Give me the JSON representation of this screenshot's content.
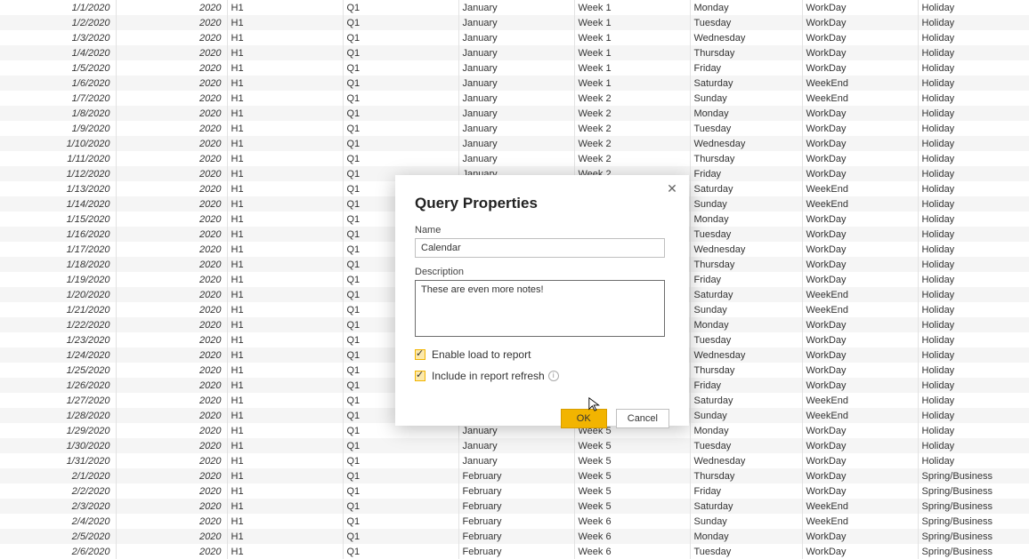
{
  "dialog": {
    "title": "Query Properties",
    "name_label": "Name",
    "name_value": "Calendar",
    "desc_label": "Description",
    "desc_value": "These are even more notes!",
    "chk_load": "Enable load to report",
    "chk_refresh": "Include in report refresh",
    "ok": "OK",
    "cancel": "Cancel"
  },
  "rows": [
    {
      "date": "1/1/2020",
      "year": "2020",
      "half": "H1",
      "q": "Q1",
      "month": "January",
      "week": "Week 1",
      "day": "Monday",
      "wk": "WorkDay",
      "hol": "Holiday"
    },
    {
      "date": "1/2/2020",
      "year": "2020",
      "half": "H1",
      "q": "Q1",
      "month": "January",
      "week": "Week 1",
      "day": "Tuesday",
      "wk": "WorkDay",
      "hol": "Holiday"
    },
    {
      "date": "1/3/2020",
      "year": "2020",
      "half": "H1",
      "q": "Q1",
      "month": "January",
      "week": "Week 1",
      "day": "Wednesday",
      "wk": "WorkDay",
      "hol": "Holiday"
    },
    {
      "date": "1/4/2020",
      "year": "2020",
      "half": "H1",
      "q": "Q1",
      "month": "January",
      "week": "Week 1",
      "day": "Thursday",
      "wk": "WorkDay",
      "hol": "Holiday"
    },
    {
      "date": "1/5/2020",
      "year": "2020",
      "half": "H1",
      "q": "Q1",
      "month": "January",
      "week": "Week 1",
      "day": "Friday",
      "wk": "WorkDay",
      "hol": "Holiday"
    },
    {
      "date": "1/6/2020",
      "year": "2020",
      "half": "H1",
      "q": "Q1",
      "month": "January",
      "week": "Week 1",
      "day": "Saturday",
      "wk": "WeekEnd",
      "hol": "Holiday"
    },
    {
      "date": "1/7/2020",
      "year": "2020",
      "half": "H1",
      "q": "Q1",
      "month": "January",
      "week": "Week 2",
      "day": "Sunday",
      "wk": "WeekEnd",
      "hol": "Holiday"
    },
    {
      "date": "1/8/2020",
      "year": "2020",
      "half": "H1",
      "q": "Q1",
      "month": "January",
      "week": "Week 2",
      "day": "Monday",
      "wk": "WorkDay",
      "hol": "Holiday"
    },
    {
      "date": "1/9/2020",
      "year": "2020",
      "half": "H1",
      "q": "Q1",
      "month": "January",
      "week": "Week 2",
      "day": "Tuesday",
      "wk": "WorkDay",
      "hol": "Holiday"
    },
    {
      "date": "1/10/2020",
      "year": "2020",
      "half": "H1",
      "q": "Q1",
      "month": "January",
      "week": "Week 2",
      "day": "Wednesday",
      "wk": "WorkDay",
      "hol": "Holiday"
    },
    {
      "date": "1/11/2020",
      "year": "2020",
      "half": "H1",
      "q": "Q1",
      "month": "January",
      "week": "Week 2",
      "day": "Thursday",
      "wk": "WorkDay",
      "hol": "Holiday"
    },
    {
      "date": "1/12/2020",
      "year": "2020",
      "half": "H1",
      "q": "Q1",
      "month": "January",
      "week": "Week 2",
      "day": "Friday",
      "wk": "WorkDay",
      "hol": "Holiday"
    },
    {
      "date": "1/13/2020",
      "year": "2020",
      "half": "H1",
      "q": "Q1",
      "month": "",
      "week": "",
      "day": "Saturday",
      "wk": "WeekEnd",
      "hol": "Holiday"
    },
    {
      "date": "1/14/2020",
      "year": "2020",
      "half": "H1",
      "q": "Q1",
      "month": "",
      "week": "",
      "day": "Sunday",
      "wk": "WeekEnd",
      "hol": "Holiday"
    },
    {
      "date": "1/15/2020",
      "year": "2020",
      "half": "H1",
      "q": "Q1",
      "month": "",
      "week": "",
      "day": "Monday",
      "wk": "WorkDay",
      "hol": "Holiday"
    },
    {
      "date": "1/16/2020",
      "year": "2020",
      "half": "H1",
      "q": "Q1",
      "month": "",
      "week": "",
      "day": "Tuesday",
      "wk": "WorkDay",
      "hol": "Holiday"
    },
    {
      "date": "1/17/2020",
      "year": "2020",
      "half": "H1",
      "q": "Q1",
      "month": "",
      "week": "",
      "day": "Wednesday",
      "wk": "WorkDay",
      "hol": "Holiday"
    },
    {
      "date": "1/18/2020",
      "year": "2020",
      "half": "H1",
      "q": "Q1",
      "month": "",
      "week": "",
      "day": "Thursday",
      "wk": "WorkDay",
      "hol": "Holiday"
    },
    {
      "date": "1/19/2020",
      "year": "2020",
      "half": "H1",
      "q": "Q1",
      "month": "",
      "week": "",
      "day": "Friday",
      "wk": "WorkDay",
      "hol": "Holiday"
    },
    {
      "date": "1/20/2020",
      "year": "2020",
      "half": "H1",
      "q": "Q1",
      "month": "",
      "week": "",
      "day": "Saturday",
      "wk": "WeekEnd",
      "hol": "Holiday"
    },
    {
      "date": "1/21/2020",
      "year": "2020",
      "half": "H1",
      "q": "Q1",
      "month": "",
      "week": "",
      "day": "Sunday",
      "wk": "WeekEnd",
      "hol": "Holiday"
    },
    {
      "date": "1/22/2020",
      "year": "2020",
      "half": "H1",
      "q": "Q1",
      "month": "",
      "week": "",
      "day": "Monday",
      "wk": "WorkDay",
      "hol": "Holiday"
    },
    {
      "date": "1/23/2020",
      "year": "2020",
      "half": "H1",
      "q": "Q1",
      "month": "",
      "week": "",
      "day": "Tuesday",
      "wk": "WorkDay",
      "hol": "Holiday"
    },
    {
      "date": "1/24/2020",
      "year": "2020",
      "half": "H1",
      "q": "Q1",
      "month": "",
      "week": "",
      "day": "Wednesday",
      "wk": "WorkDay",
      "hol": "Holiday"
    },
    {
      "date": "1/25/2020",
      "year": "2020",
      "half": "H1",
      "q": "Q1",
      "month": "",
      "week": "",
      "day": "Thursday",
      "wk": "WorkDay",
      "hol": "Holiday"
    },
    {
      "date": "1/26/2020",
      "year": "2020",
      "half": "H1",
      "q": "Q1",
      "month": "",
      "week": "",
      "day": "Friday",
      "wk": "WorkDay",
      "hol": "Holiday"
    },
    {
      "date": "1/27/2020",
      "year": "2020",
      "half": "H1",
      "q": "Q1",
      "month": "",
      "week": "",
      "day": "Saturday",
      "wk": "WeekEnd",
      "hol": "Holiday"
    },
    {
      "date": "1/28/2020",
      "year": "2020",
      "half": "H1",
      "q": "Q1",
      "month": "",
      "week": "",
      "day": "Sunday",
      "wk": "WeekEnd",
      "hol": "Holiday"
    },
    {
      "date": "1/29/2020",
      "year": "2020",
      "half": "H1",
      "q": "Q1",
      "month": "January",
      "week": "Week 5",
      "day": "Monday",
      "wk": "WorkDay",
      "hol": "Holiday"
    },
    {
      "date": "1/30/2020",
      "year": "2020",
      "half": "H1",
      "q": "Q1",
      "month": "January",
      "week": "Week 5",
      "day": "Tuesday",
      "wk": "WorkDay",
      "hol": "Holiday"
    },
    {
      "date": "1/31/2020",
      "year": "2020",
      "half": "H1",
      "q": "Q1",
      "month": "January",
      "week": "Week 5",
      "day": "Wednesday",
      "wk": "WorkDay",
      "hol": "Holiday"
    },
    {
      "date": "2/1/2020",
      "year": "2020",
      "half": "H1",
      "q": "Q1",
      "month": "February",
      "week": "Week 5",
      "day": "Thursday",
      "wk": "WorkDay",
      "hol": "Spring/Business"
    },
    {
      "date": "2/2/2020",
      "year": "2020",
      "half": "H1",
      "q": "Q1",
      "month": "February",
      "week": "Week 5",
      "day": "Friday",
      "wk": "WorkDay",
      "hol": "Spring/Business"
    },
    {
      "date": "2/3/2020",
      "year": "2020",
      "half": "H1",
      "q": "Q1",
      "month": "February",
      "week": "Week 5",
      "day": "Saturday",
      "wk": "WeekEnd",
      "hol": "Spring/Business"
    },
    {
      "date": "2/4/2020",
      "year": "2020",
      "half": "H1",
      "q": "Q1",
      "month": "February",
      "week": "Week 6",
      "day": "Sunday",
      "wk": "WeekEnd",
      "hol": "Spring/Business"
    },
    {
      "date": "2/5/2020",
      "year": "2020",
      "half": "H1",
      "q": "Q1",
      "month": "February",
      "week": "Week 6",
      "day": "Monday",
      "wk": "WorkDay",
      "hol": "Spring/Business"
    },
    {
      "date": "2/6/2020",
      "year": "2020",
      "half": "H1",
      "q": "Q1",
      "month": "February",
      "week": "Week 6",
      "day": "Tuesday",
      "wk": "WorkDay",
      "hol": "Spring/Business"
    }
  ]
}
